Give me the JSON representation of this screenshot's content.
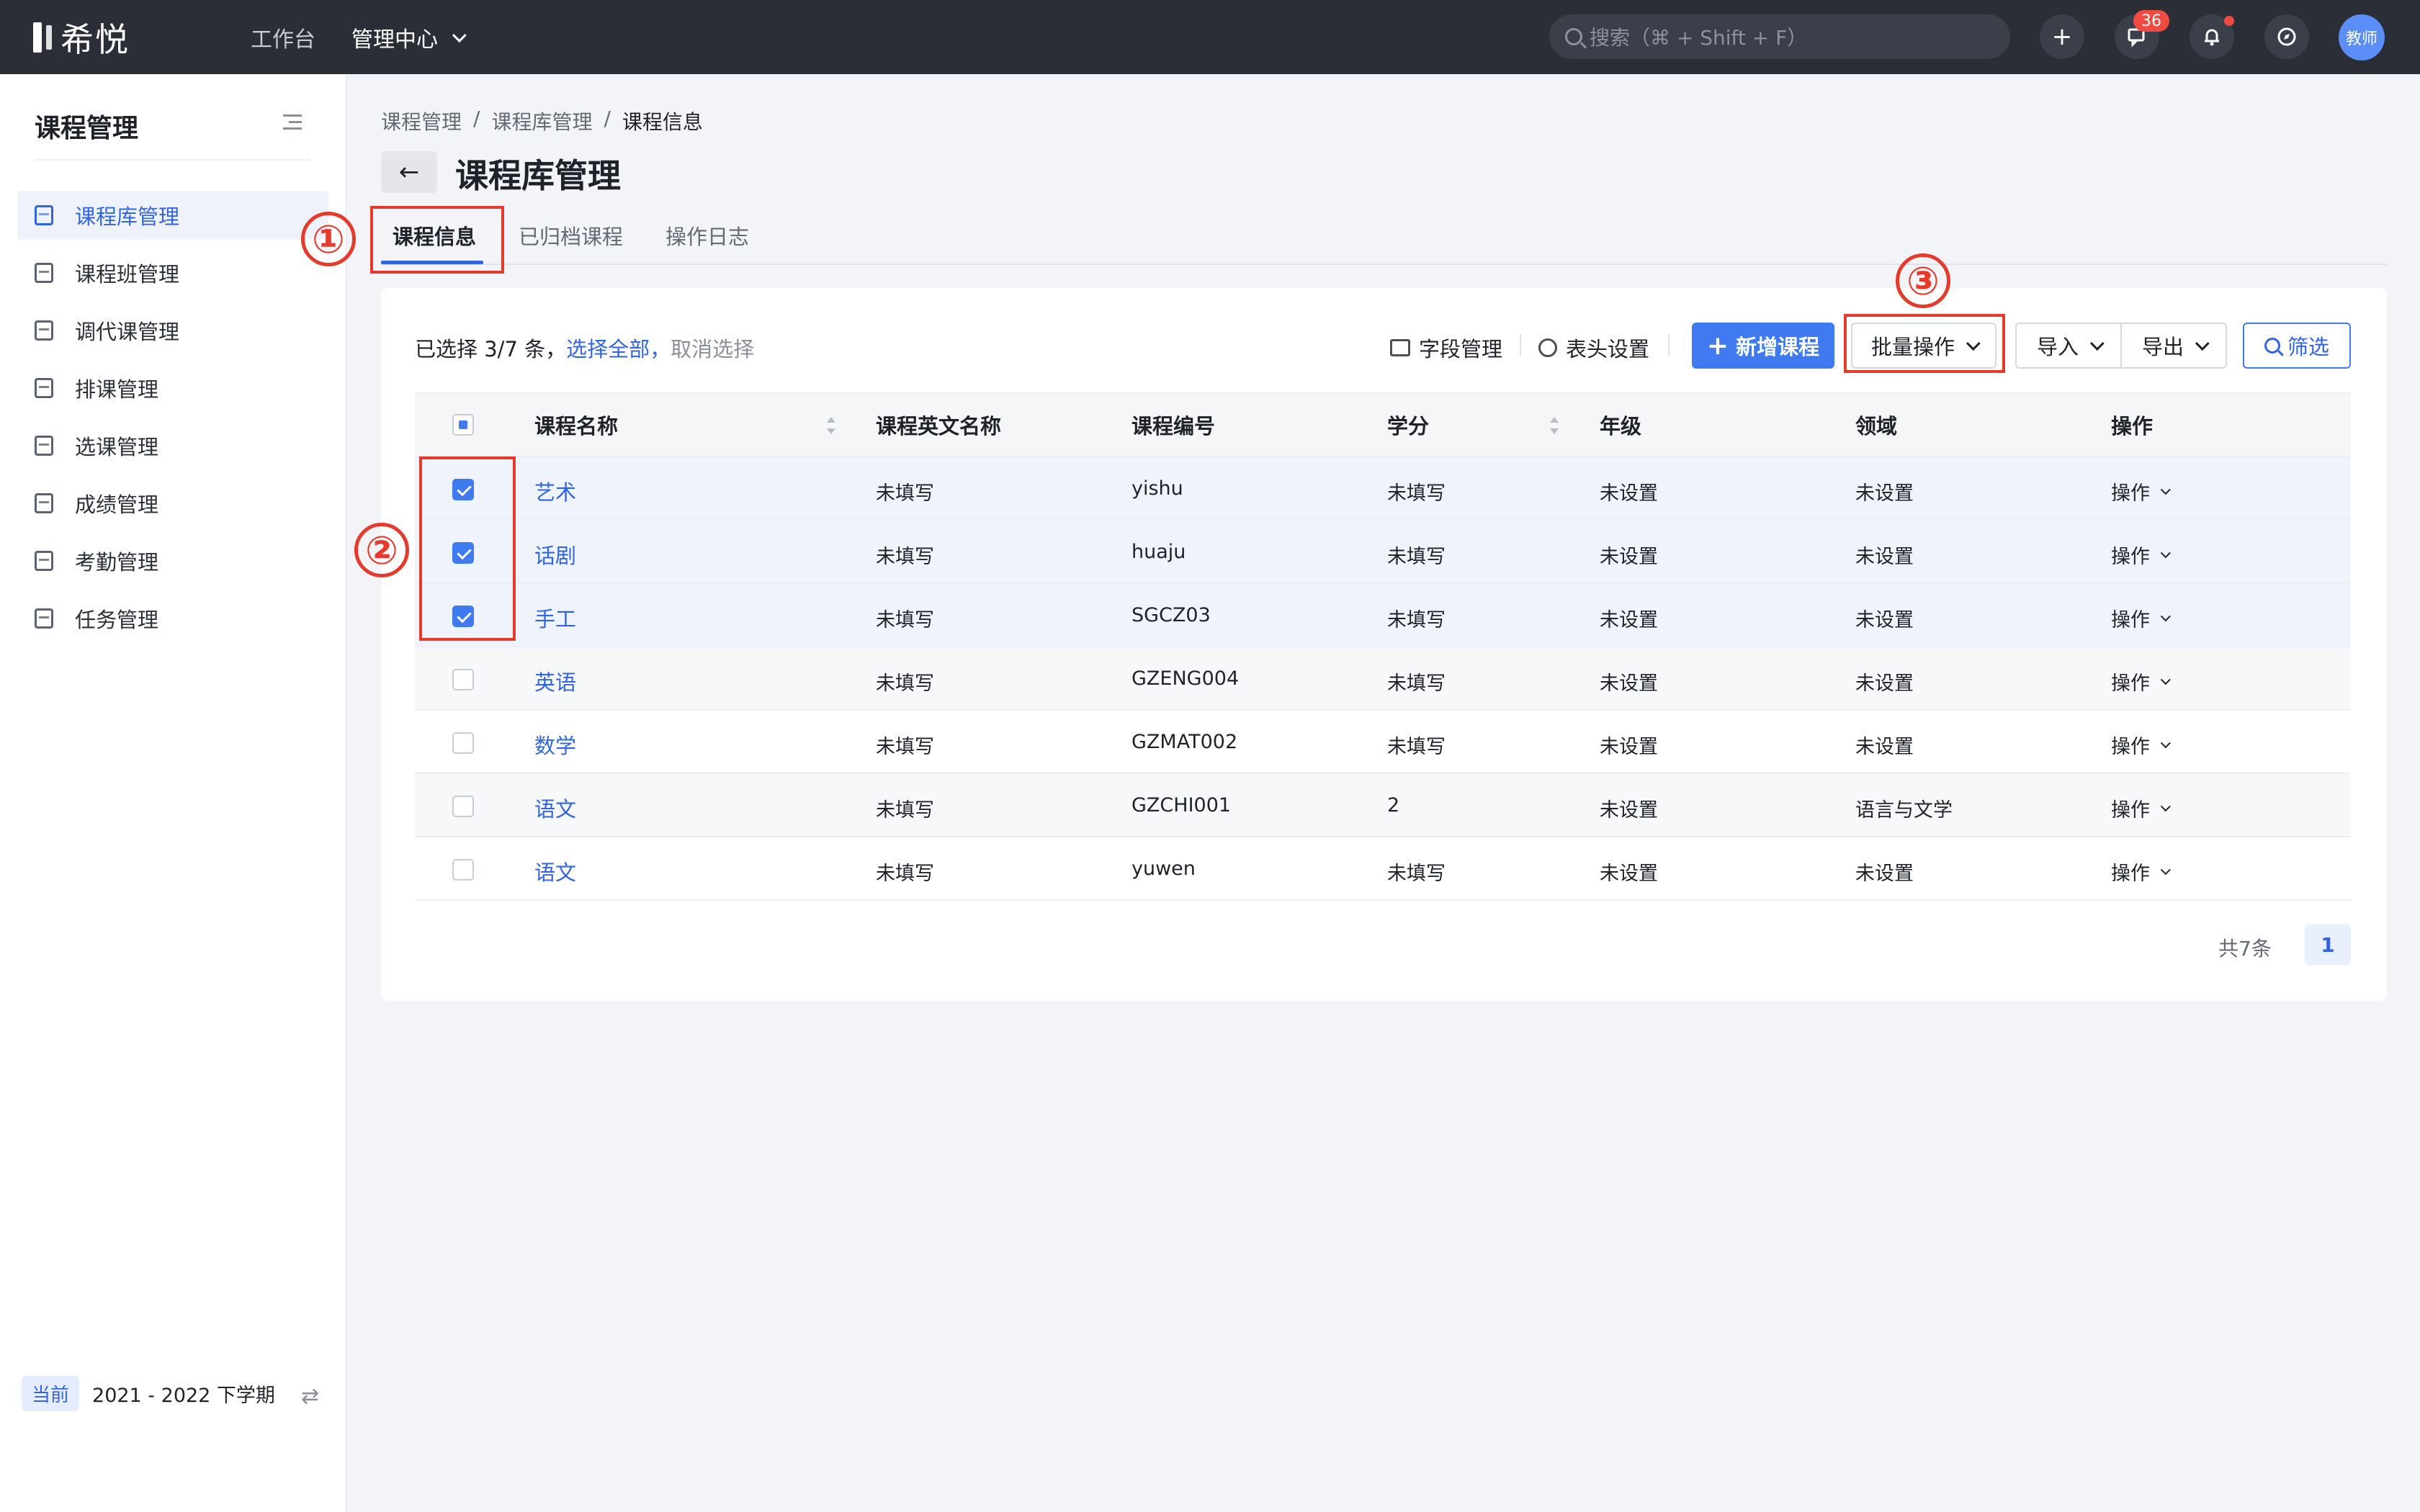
{
  "app": {
    "logo_text": "希悦"
  },
  "topnav": {
    "items": [
      {
        "label": "工作台"
      },
      {
        "label": "管理中心"
      }
    ]
  },
  "search": {
    "placeholder": "搜索（⌘ + Shift + F）"
  },
  "header": {
    "add_symbol": "+",
    "message_count": "36",
    "avatar_text": "教师"
  },
  "sidebar": {
    "title": "课程管理",
    "items": [
      {
        "label": "课程库管理",
        "active": true
      },
      {
        "label": "课程班管理"
      },
      {
        "label": "调代课管理"
      },
      {
        "label": "排课管理"
      },
      {
        "label": "选课管理"
      },
      {
        "label": "成绩管理"
      },
      {
        "label": "考勤管理"
      },
      {
        "label": "任务管理"
      }
    ],
    "term_tag": "当前",
    "term_text": "2021 - 2022 下学期"
  },
  "breadcrumb": [
    "课程管理",
    "/",
    "课程库管理",
    "/",
    "课程信息"
  ],
  "page_title": "课程库管理",
  "tabs": [
    {
      "label": "课程信息",
      "active": true
    },
    {
      "label": "已归档课程"
    },
    {
      "label": "操作日志"
    }
  ],
  "selection": {
    "text": "已选择 3/7 条，",
    "select_all": "选择全部，",
    "cancel": "取消选择"
  },
  "toolbar": {
    "field_manage": "字段管理",
    "header_settings": "表头设置",
    "add_course": "新增课程",
    "batch_ops": "批量操作",
    "import": "导入",
    "export": "导出",
    "filter": "筛选"
  },
  "table": {
    "columns": [
      "课程名称",
      "课程英文名称",
      "课程编号",
      "学分",
      "年级",
      "领域",
      "操作"
    ],
    "rows": [
      {
        "checked": true,
        "name": "艺术",
        "en": "未填写",
        "code": "yishu",
        "credit": "未填写",
        "grade": "未设置",
        "field": "未设置",
        "op": "操作"
      },
      {
        "checked": true,
        "name": "话剧",
        "en": "未填写",
        "code": "huaju",
        "credit": "未填写",
        "grade": "未设置",
        "field": "未设置",
        "op": "操作"
      },
      {
        "checked": true,
        "name": "手工",
        "en": "未填写",
        "code": "SGCZ03",
        "credit": "未填写",
        "grade": "未设置",
        "field": "未设置",
        "op": "操作"
      },
      {
        "checked": false,
        "name": "英语",
        "en": "未填写",
        "code": "GZENG004",
        "credit": "未填写",
        "grade": "未设置",
        "field": "未设置",
        "op": "操作"
      },
      {
        "checked": false,
        "name": "数学",
        "en": "未填写",
        "code": "GZMAT002",
        "credit": "未填写",
        "grade": "未设置",
        "field": "未设置",
        "op": "操作"
      },
      {
        "checked": false,
        "name": "语文",
        "en": "未填写",
        "code": "GZCHI001",
        "credit": "2",
        "grade": "未设置",
        "field": "语言与文学",
        "op": "操作"
      },
      {
        "checked": false,
        "name": "语文",
        "en": "未填写",
        "code": "yuwen",
        "credit": "未填写",
        "grade": "未设置",
        "field": "未设置",
        "op": "操作"
      }
    ]
  },
  "pagination": {
    "total": "共7条",
    "current": "1"
  },
  "annotations": [
    "①",
    "②",
    "③"
  ],
  "colors": {
    "accent": "#3265dd",
    "primary_button": "#3f7af0",
    "annotation": "#e53b2c",
    "topbar": "#2b2e37"
  }
}
